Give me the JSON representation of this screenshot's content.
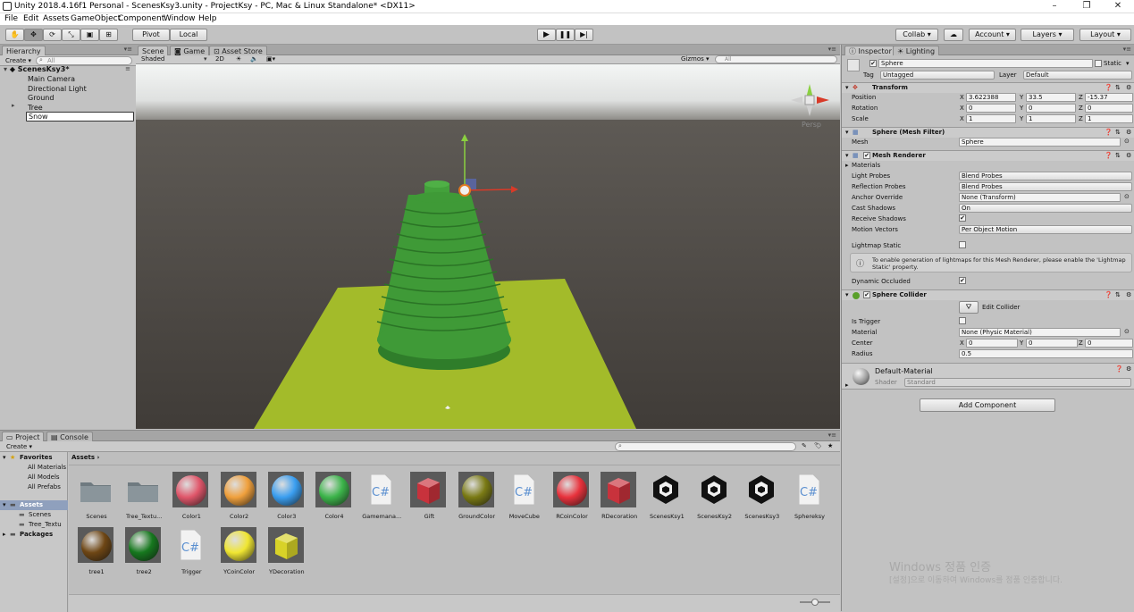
{
  "window": {
    "title": "Unity 2018.4.16f1 Personal - ScenesKsy3.unity - ProjectKsy - PC, Mac & Linux Standalone* <DX11>",
    "minimize": "–",
    "maximize": "❐",
    "close": "✕"
  },
  "menu": [
    "File",
    "Edit",
    "Assets",
    "GameObject",
    "Component",
    "Window",
    "Help"
  ],
  "toolbar": {
    "pivot": "Pivot",
    "local": "Local",
    "collab": "Collab ▾",
    "account": "Account ▾",
    "layers": "Layers ▾",
    "layout": "Layout ▾"
  },
  "hierarchy": {
    "tab": "Hierarchy",
    "create": "Create ▾",
    "search_placeholder": "All",
    "scene": "ScenesKsy3*",
    "items": [
      {
        "label": "Main Camera"
      },
      {
        "label": "Directional Light"
      },
      {
        "label": "Ground"
      },
      {
        "label": "Tree"
      },
      {
        "label": "Snow"
      }
    ]
  },
  "scene_view": {
    "tabs": [
      "Scene",
      "Game",
      "Asset Store"
    ],
    "shading": "Shaded",
    "mode_2d": "2D",
    "gizmos": "Gizmos ▾",
    "search_placeholder": "All",
    "persp": "Persp",
    "colors": {
      "sky": "#ecefee",
      "ground": "#4a4642",
      "plane": "#a3bb2a",
      "tree": "#3f9a37"
    }
  },
  "inspector": {
    "tabs": [
      "Inspector",
      "Lighting"
    ],
    "object_name": "Sphere",
    "static_label": "Static",
    "tag_label": "Tag",
    "tag_value": "Untagged",
    "layer_label": "Layer",
    "layer_value": "Default",
    "transform": {
      "title": "Transform",
      "position": {
        "label": "Position",
        "x": "3.622388",
        "y": "33.5",
        "z": "-15.37"
      },
      "rotation": {
        "label": "Rotation",
        "x": "0",
        "y": "0",
        "z": "0"
      },
      "scale": {
        "label": "Scale",
        "x": "1",
        "y": "1",
        "z": "1"
      }
    },
    "mesh_filter": {
      "title": "Sphere (Mesh Filter)",
      "mesh_label": "Mesh",
      "mesh_value": "Sphere"
    },
    "mesh_renderer": {
      "title": "Mesh Renderer",
      "materials": "Materials",
      "rows": [
        {
          "label": "Light Probes",
          "value": "Blend Probes"
        },
        {
          "label": "Reflection Probes",
          "value": "Blend Probes"
        },
        {
          "label": "Anchor Override",
          "value": "None (Transform)"
        },
        {
          "label": "Cast Shadows",
          "value": "On"
        },
        {
          "label": "Receive Shadows",
          "value": ""
        },
        {
          "label": "Motion Vectors",
          "value": "Per Object Motion"
        }
      ],
      "lightmap_static": "Lightmap Static",
      "info": "To enable generation of lightmaps for this Mesh Renderer, please enable the 'Lightmap Static' property.",
      "dynamic_occluded": "Dynamic Occluded"
    },
    "sphere_collider": {
      "title": "Sphere Collider",
      "edit_collider": "Edit Collider",
      "is_trigger": "Is Trigger",
      "material_label": "Material",
      "material_value": "None (Physic Material)",
      "center_label": "Center",
      "center": {
        "x": "0",
        "y": "0",
        "z": "0"
      },
      "radius_label": "Radius",
      "radius": "0.5"
    },
    "material": {
      "name": "Default-Material",
      "shader_label": "Shader",
      "shader_value": "Standard"
    },
    "add_component": "Add Component"
  },
  "project": {
    "tabs": [
      "Project",
      "Console"
    ],
    "create": "Create ▾",
    "breadcrumb": "Assets",
    "favorites": {
      "title": "Favorites",
      "items": [
        "All Materials",
        "All Models",
        "All Prefabs"
      ]
    },
    "assets_tree": {
      "title": "Assets",
      "items": [
        "Scenes",
        "Tree_Textu"
      ]
    },
    "packages": "Packages",
    "assets": [
      {
        "name": "Scenes",
        "kind": "folder"
      },
      {
        "name": "Tree_Textu...",
        "kind": "folder"
      },
      {
        "name": "Color1",
        "kind": "sphere",
        "color": "#e0566a"
      },
      {
        "name": "Color2",
        "kind": "sphere",
        "color": "#f0a03c"
      },
      {
        "name": "Color3",
        "kind": "sphere",
        "color": "#3a9ef0"
      },
      {
        "name": "Color4",
        "kind": "sphere",
        "color": "#3cb44a"
      },
      {
        "name": "Gamemana...",
        "kind": "script"
      },
      {
        "name": "Gift",
        "kind": "cube",
        "color": "#c8323c"
      },
      {
        "name": "GroundColor",
        "kind": "sphere",
        "color": "#7a7a14"
      },
      {
        "name": "MoveCube",
        "kind": "script"
      },
      {
        "name": "RCoinColor",
        "kind": "sphere",
        "color": "#e8323c"
      },
      {
        "name": "RDecoration",
        "kind": "cube",
        "color": "#c8323c"
      },
      {
        "name": "ScenesKsy1",
        "kind": "unity"
      },
      {
        "name": "ScenesKsy2",
        "kind": "unity"
      },
      {
        "name": "ScenesKsy3",
        "kind": "unity"
      },
      {
        "name": "Sphereksy",
        "kind": "script"
      },
      {
        "name": "tree1",
        "kind": "sphere",
        "color": "#6e4614"
      },
      {
        "name": "tree2",
        "kind": "sphere",
        "color": "#16781e"
      },
      {
        "name": "Trigger",
        "kind": "script"
      },
      {
        "name": "YCoinColor",
        "kind": "sphere",
        "color": "#f0e632"
      },
      {
        "name": "YDecoration",
        "kind": "cube",
        "color": "#d8d228"
      }
    ]
  },
  "watermark": {
    "line1": "Windows 정품 인증",
    "line2": "[설정]으로 이동하여 Windows를 정품 인증합니다."
  }
}
